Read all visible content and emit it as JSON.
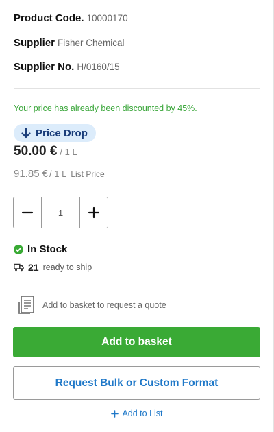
{
  "product": {
    "code_label": "Product Code.",
    "code_value": "10000170",
    "supplier_label": "Supplier",
    "supplier_value": "Fisher Chemical",
    "supplier_no_label": "Supplier No.",
    "supplier_no_value": "H/0160/15"
  },
  "pricing": {
    "discount_note": "Your price has already been discounted by 45%.",
    "badge_label": "Price Drop",
    "price": "50.00 €",
    "price_unit": "/ 1 L",
    "list_price": "91.85 €",
    "list_price_unit": "/ 1 L",
    "list_price_label": "List Price"
  },
  "quantity": {
    "value": "1",
    "decrement_icon": "minus-icon",
    "increment_icon": "plus-icon"
  },
  "availability": {
    "status": "In Stock",
    "ready_count": "21",
    "ready_text": "ready to ship"
  },
  "quote": {
    "text": "Add to basket to request a quote"
  },
  "actions": {
    "basket_label": "Add to basket",
    "bulk_label": "Request Bulk or Custom Format",
    "add_list_label": "Add to List"
  },
  "colors": {
    "accent_green": "#3aaa35",
    "link_blue": "#1f78c8",
    "badge_bg": "#dcecfb",
    "badge_text": "#1a3d7a"
  }
}
